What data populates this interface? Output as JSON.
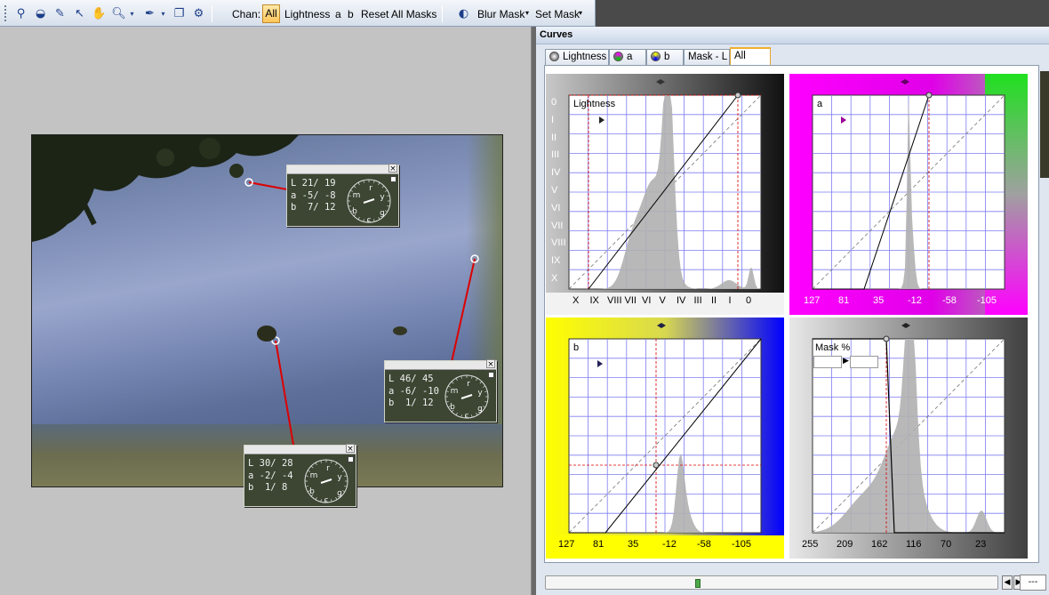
{
  "toolbar": {
    "chan_label": "Chan:",
    "chan_all": "All",
    "chan_lightness": "Lightness",
    "chan_a": "a",
    "chan_b": "b",
    "reset_masks": "Reset All Masks",
    "blur_mask": "Blur Mask",
    "set_mask": "Set Mask",
    "icons": [
      "grip",
      "point-sample-icon",
      "mask-icon",
      "curve-pen-icon",
      "pointer-icon",
      "hand-icon",
      "zoom-icon",
      "eyedropper-icon",
      "copy-icon",
      "wrench-icon"
    ]
  },
  "panel": {
    "title": "Curves",
    "tabs": [
      {
        "label": "Lightness",
        "icon": "lightness-icon"
      },
      {
        "label": "a",
        "icon": "a-channel-icon"
      },
      {
        "label": "b",
        "icon": "b-channel-icon"
      },
      {
        "label": "Mask - L",
        "icon": ""
      },
      {
        "label": "All",
        "icon": "",
        "active": true
      }
    ]
  },
  "samplers": [
    {
      "L": "21/ 19",
      "a": "-5/ -8",
      "b": " 7/ 12"
    },
    {
      "L": "46/ 45",
      "a": "-6/ -10",
      "b": " 1/ 12"
    },
    {
      "L": "30/ 28",
      "a": "-2/ -4",
      "b": " 1/ 8"
    }
  ],
  "dial_labels": {
    "m": "m",
    "r": "r",
    "y": "y",
    "g": "g",
    "c": "c",
    "b": "b"
  },
  "curves": {
    "lightness": {
      "name": "Lightness",
      "zones_left": [
        "0",
        "I",
        "II",
        "III",
        "IV",
        "V",
        "VI",
        "VII",
        "VIII",
        "IX",
        "X"
      ],
      "zones_bottom": [
        "X",
        "IX",
        "VIII",
        "VII",
        "VI",
        "V",
        "IV",
        "III",
        "II",
        "I",
        "0"
      ]
    },
    "a": {
      "name": "a",
      "scale": [
        "127",
        "81",
        "35",
        "-12",
        "-58",
        "-105"
      ]
    },
    "b": {
      "name": "b",
      "scale": [
        "127",
        "81",
        "35",
        "-12",
        "-58",
        "-105"
      ]
    },
    "mask": {
      "name": "Mask %",
      "scale": [
        "255",
        "209",
        "162",
        "116",
        "70",
        "23"
      ]
    }
  },
  "bottom": {
    "zoom_field": "---"
  },
  "colors": {
    "accent": "#f0b030",
    "grid": "#7d7df0",
    "line": "#000000",
    "red_line": "#dd0000"
  }
}
